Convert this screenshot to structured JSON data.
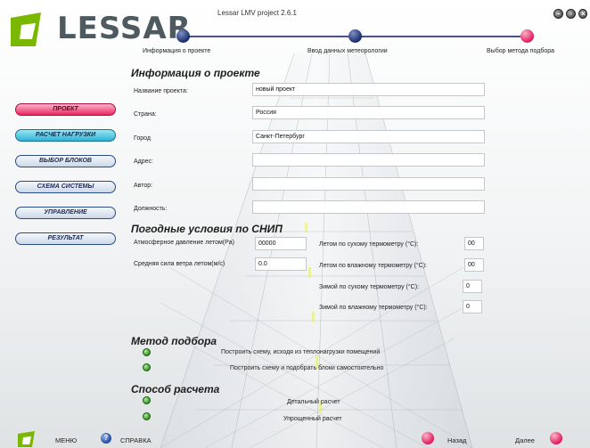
{
  "app": {
    "brand": "LESSAR",
    "title": "Lessar LMV project 2.6.1"
  },
  "window_controls": [
    "minimize-icon",
    "restore-icon",
    "close-icon"
  ],
  "steps": [
    {
      "label": "Информация о проекте",
      "state": "done"
    },
    {
      "label": "Ввод данных метеорологии",
      "state": "done"
    },
    {
      "label": "Выбор метода подбора",
      "state": "current"
    }
  ],
  "nav": {
    "items": [
      {
        "label": "ПРОЕКТ",
        "state": "active"
      },
      {
        "label": "РАСЧЕТ НАГРУЗКИ",
        "state": "highlight"
      },
      {
        "label": "ВЫБОР БЛОКОВ",
        "state": "normal"
      },
      {
        "label": "СХЕМА СИСТЕМЫ",
        "state": "normal"
      },
      {
        "label": "УПРАВЛЕНИЕ",
        "state": "normal"
      },
      {
        "label": "РЕЗУЛЬТАТ",
        "state": "normal"
      }
    ]
  },
  "project_info": {
    "title": "Информация о проекте",
    "fields": [
      {
        "label": "Название проекта:",
        "value": "новый проект"
      },
      {
        "label": "Страна:",
        "value": "Россия"
      },
      {
        "label": "Город",
        "value": "Санкт-Петербург"
      },
      {
        "label": "Адрес:",
        "value": ""
      },
      {
        "label": "Автор:",
        "value": ""
      },
      {
        "label": "Должность:",
        "value": ""
      }
    ]
  },
  "weather": {
    "title": "Погодные условия по СНИП",
    "left": [
      {
        "label": "Атмосферное давление летом(Pa)",
        "value": "00000"
      },
      {
        "label": "Средняя сила ветра летом(м/с)",
        "value": "0.0"
      }
    ],
    "right": [
      {
        "label": "Летом по сухому термометру (°С):",
        "value": "00"
      },
      {
        "label": "Летом по влажному термометру (°С):",
        "value": "00"
      },
      {
        "label": "Зимой по сухому термометру (°С):",
        "value": "0"
      },
      {
        "label": "Зимой по влажному термометру (°С):",
        "value": "0"
      }
    ]
  },
  "selection_method": {
    "title": "Метод подбора",
    "options": [
      "Построить схему, исходя из теплонагрузки помещений",
      "Построить схему и подобрать блоки самостоятельно"
    ]
  },
  "calc_method": {
    "title": "Способ расчета",
    "options": [
      "Детальный расчет",
      "Упрощенный расчет"
    ]
  },
  "footer": {
    "menu": "МЕНЮ",
    "help": "СПРАВКА",
    "back": "Назад",
    "next": "Далее"
  },
  "colors": {
    "brand_green": "#7ab800",
    "active_pink": "#e8265f",
    "highlight_cyan": "#2fb4d6",
    "step_blue": "#1b2d6b",
    "radio_green": "#2d8a1f"
  }
}
